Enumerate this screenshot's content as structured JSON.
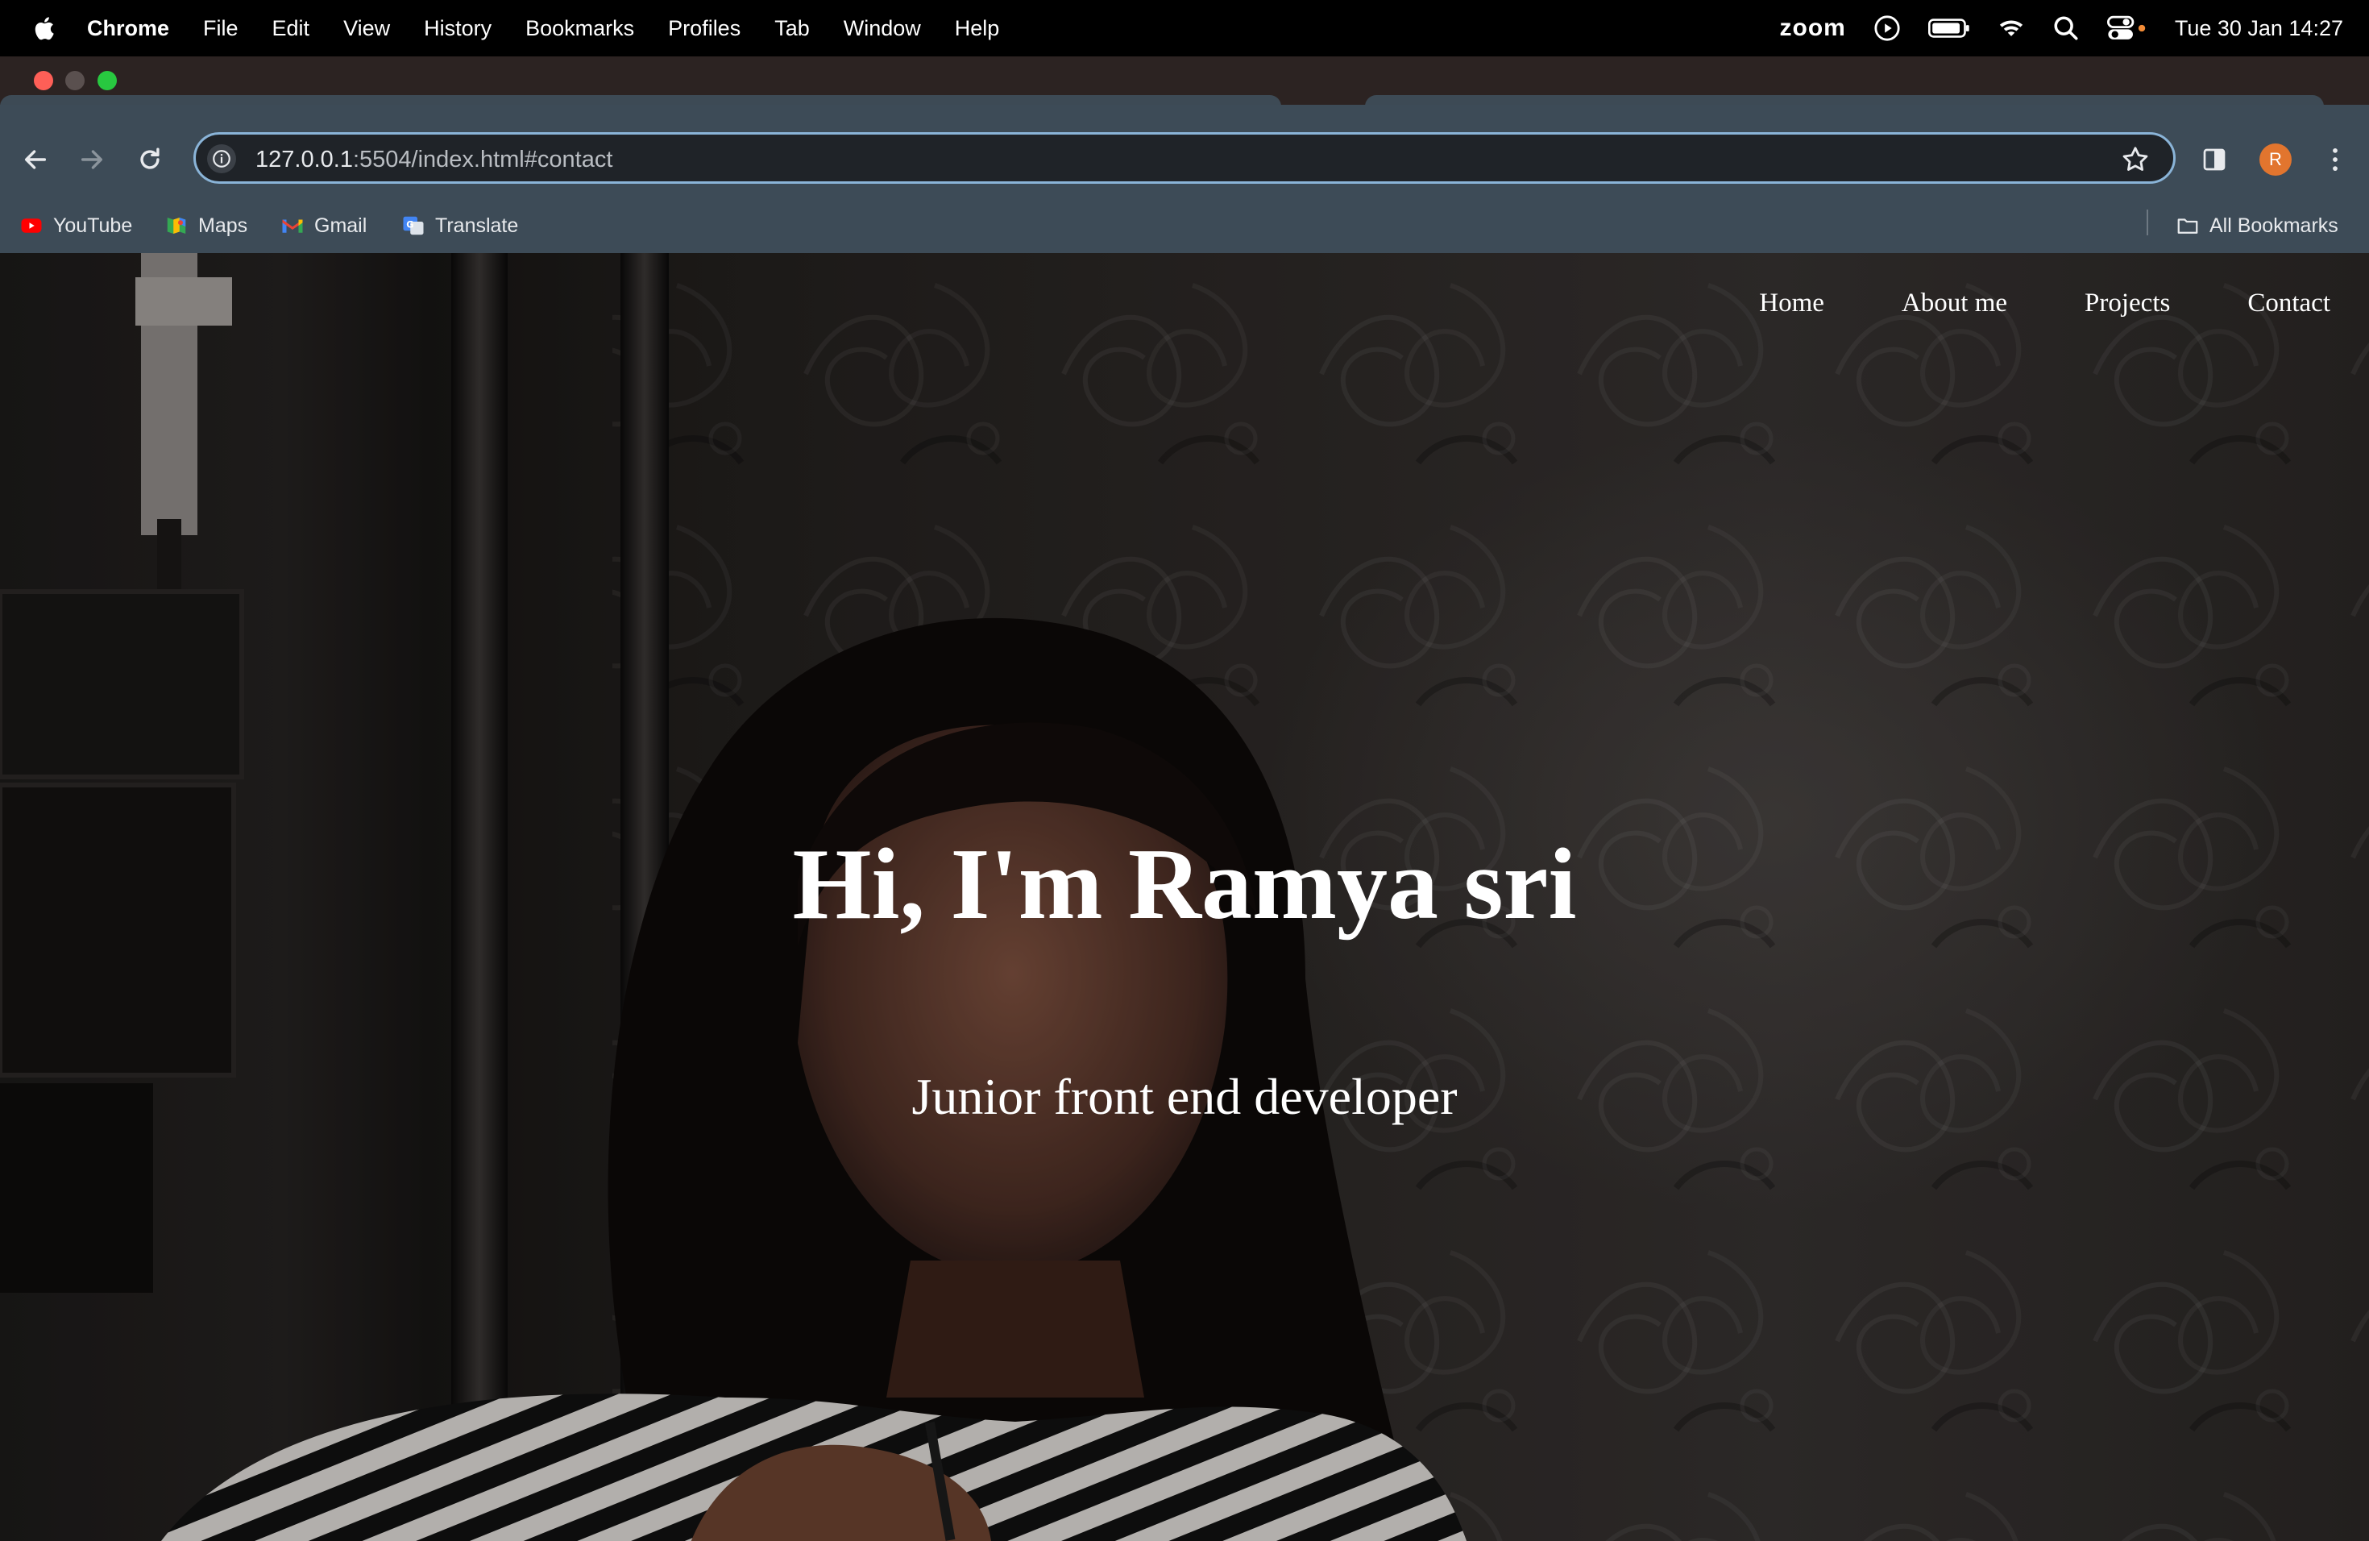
{
  "menubar": {
    "app_name": "Chrome",
    "items": [
      "File",
      "Edit",
      "View",
      "History",
      "Bookmarks",
      "Profiles",
      "Tab",
      "Window",
      "Help"
    ],
    "zoom_label": "zoom",
    "clock": "Tue 30 Jan  14:27"
  },
  "browser": {
    "url_host": "127.0.0.1",
    "url_rest": ":5504/index.html#contact",
    "profile_initial": "R",
    "bookmarks": [
      {
        "label": "YouTube",
        "icon": "youtube-icon"
      },
      {
        "label": "Maps",
        "icon": "maps-icon"
      },
      {
        "label": "Gmail",
        "icon": "gmail-icon"
      },
      {
        "label": "Translate",
        "icon": "translate-icon"
      }
    ],
    "all_bookmarks_label": "All Bookmarks"
  },
  "site": {
    "nav": [
      "Home",
      "About me",
      "Projects",
      "Contact"
    ],
    "hero_title": "Hi, I'm Ramya sri",
    "hero_subtitle": "Junior front end developer"
  },
  "colors": {
    "accent_focus": "#8ab4d8",
    "toolbar": "#3d4b57",
    "avatar": "#e2752e"
  }
}
